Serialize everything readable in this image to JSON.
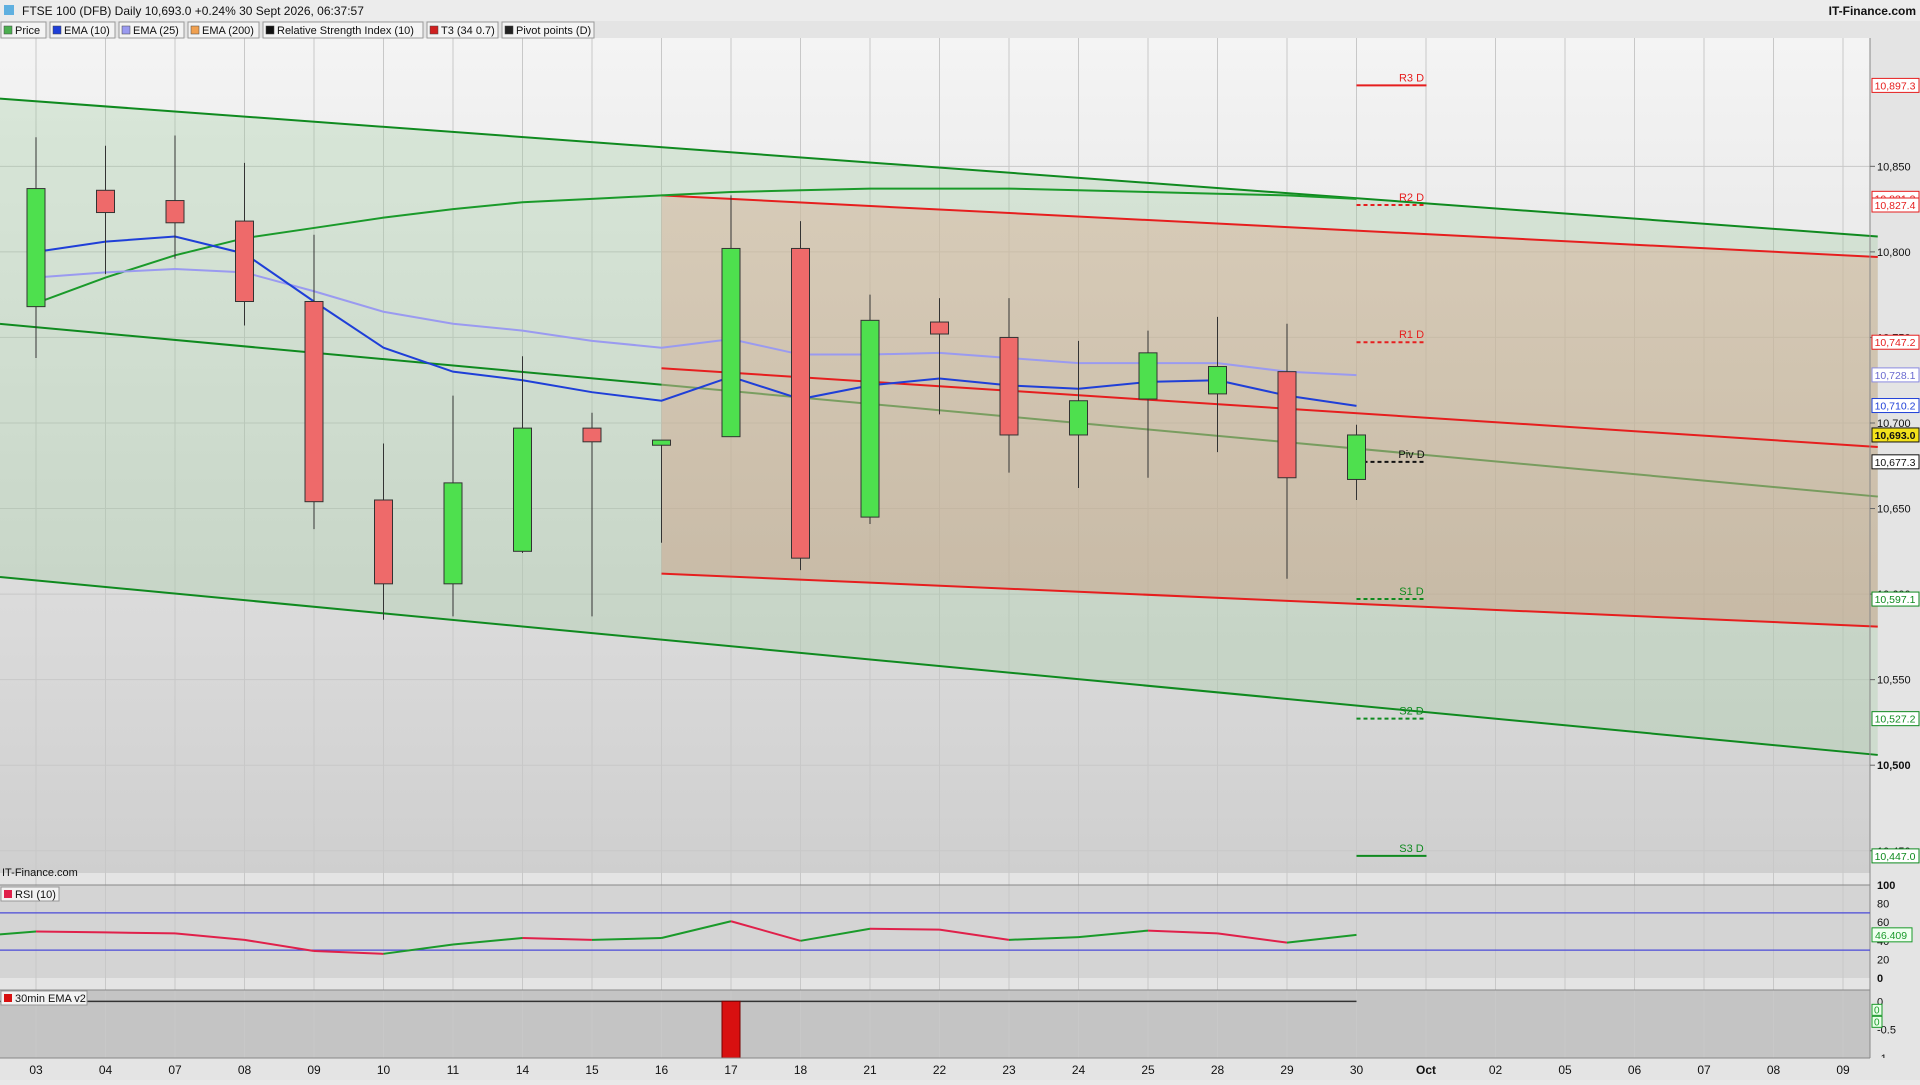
{
  "header": {
    "title": "FTSE 100 (DFB) Daily 10,693.0 +0.24% 30 Sept 2026, 06:37:57",
    "brand": "IT-Finance.com",
    "watermark": "IT-Finance.com"
  },
  "legend": [
    {
      "label": "Price",
      "color": "#4caf50"
    },
    {
      "label": "EMA (10)",
      "color": "#1f3fd8"
    },
    {
      "label": "EMA (25)",
      "color": "#9a9af0"
    },
    {
      "label": "EMA (200)",
      "color": "#f0a050"
    },
    {
      "label": "Relative Strength Index (10)",
      "color": "#111111"
    },
    {
      "label": "T3 (34 0.7)",
      "color": "#d02020"
    },
    {
      "label": "Pivot points (D)",
      "color": "#222222"
    }
  ],
  "colors": {
    "up": "#4ee04e",
    "down": "#ee6a6a",
    "ema10": "#1f3fd8",
    "ema25": "#9a9af0",
    "ema200": "#1a9a2a",
    "channel_green": "#0f8a1f",
    "channel_red": "#e61e1e",
    "rsi_up": "#1a9a2a",
    "rsi_down": "#e0204a"
  },
  "chart_data": [
    {
      "type": "candlestick",
      "title": "FTSE 100 (DFB) Daily",
      "x_ticks": [
        "03",
        "04",
        "07",
        "08",
        "09",
        "10",
        "11",
        "14",
        "15",
        "16",
        "17",
        "18",
        "21",
        "22",
        "23",
        "24",
        "25",
        "28",
        "29",
        "30",
        "Oct",
        "02",
        "05",
        "06",
        "07",
        "08",
        "09"
      ],
      "y_ticks": [
        "10,850",
        "10,800",
        "10,750",
        "10,700",
        "10,650",
        "10,600",
        "10,550",
        "10,500",
        "10,450"
      ],
      "ylim": [
        10437,
        10925
      ],
      "candles": [
        {
          "date": "03",
          "open": 10768,
          "high": 10867,
          "low": 10738,
          "close": 10837
        },
        {
          "date": "04",
          "open": 10836,
          "high": 10862,
          "low": 10787,
          "close": 10823
        },
        {
          "date": "07",
          "open": 10830,
          "high": 10868,
          "low": 10796,
          "close": 10817
        },
        {
          "date": "08",
          "open": 10818,
          "high": 10852,
          "low": 10757,
          "close": 10771
        },
        {
          "date": "09",
          "open": 10771,
          "high": 10810,
          "low": 10638,
          "close": 10654
        },
        {
          "date": "10",
          "open": 10655,
          "high": 10688,
          "low": 10585,
          "close": 10606
        },
        {
          "date": "11",
          "open": 10606,
          "high": 10716,
          "low": 10587,
          "close": 10665
        },
        {
          "date": "14",
          "open": 10625,
          "high": 10739,
          "low": 10624,
          "close": 10697
        },
        {
          "date": "15",
          "open": 10697,
          "high": 10706,
          "low": 10587,
          "close": 10689
        },
        {
          "date": "16",
          "open": 10687,
          "high": 10690,
          "low": 10630,
          "close": 10690
        },
        {
          "date": "17",
          "open": 10692,
          "high": 10833,
          "low": 10692,
          "close": 10802
        },
        {
          "date": "18",
          "open": 10802,
          "high": 10818,
          "low": 10614,
          "close": 10621
        },
        {
          "date": "21",
          "open": 10645,
          "high": 10775,
          "low": 10641,
          "close": 10760
        },
        {
          "date": "22",
          "open": 10759,
          "high": 10773,
          "low": 10705,
          "close": 10752
        },
        {
          "date": "23",
          "open": 10750,
          "high": 10773,
          "low": 10671,
          "close": 10693
        },
        {
          "date": "24",
          "open": 10693,
          "high": 10748,
          "low": 10662,
          "close": 10713
        },
        {
          "date": "25",
          "open": 10714,
          "high": 10754,
          "low": 10668,
          "close": 10741
        },
        {
          "date": "28",
          "open": 10717,
          "high": 10762,
          "low": 10683,
          "close": 10733
        },
        {
          "date": "29",
          "open": 10730,
          "high": 10758,
          "low": 10609,
          "close": 10668
        },
        {
          "date": "30",
          "open": 10667,
          "high": 10699,
          "low": 10655,
          "close": 10693
        }
      ],
      "ema10": [
        10800,
        10806,
        10809,
        10799,
        10771,
        10744,
        10730,
        10725,
        10718,
        10713,
        10727,
        10714,
        10722,
        10726,
        10722,
        10720,
        10724,
        10725,
        10716,
        10710
      ],
      "ema25": [
        10785,
        10788,
        10790,
        10788,
        10777,
        10765,
        10758,
        10754,
        10748,
        10744,
        10749,
        10740,
        10740,
        10741,
        10738,
        10735,
        10735,
        10735,
        10730,
        10728
      ],
      "ema200": [
        10770,
        10785,
        10798,
        10808,
        10814,
        10820,
        10825,
        10829,
        10831,
        10833,
        10835,
        10836,
        10837,
        10837,
        10837,
        10836,
        10835,
        10834,
        10833,
        10831
      ],
      "price_labels": [
        "10,897.3",
        "10,831.3",
        "10,827.4",
        "10,747.2",
        "10,728.1",
        "10,710.2",
        "10,693.0",
        "10,677.3",
        "10,597.1",
        "10,527.2",
        "10,447.0"
      ],
      "pivots": [
        {
          "label": "R3 D",
          "value": 10897.3,
          "style": "solid",
          "color": "#e61e1e"
        },
        {
          "label": "R2 D",
          "value": 10827.4,
          "style": "dashed",
          "color": "#e61e1e"
        },
        {
          "label": "R1 D",
          "value": 10747.2,
          "style": "dashed",
          "color": "#e61e1e"
        },
        {
          "label": "Piv D",
          "value": 10677.3,
          "style": "dashed",
          "color": "#111111"
        },
        {
          "label": "S1 D",
          "value": 10597.1,
          "style": "dashed",
          "color": "#0f8a1f"
        },
        {
          "label": "S2 D",
          "value": 10527.2,
          "style": "dashed",
          "color": "#0f8a1f"
        },
        {
          "label": "S3 D",
          "value": 10447.0,
          "style": "solid",
          "color": "#0f8a1f"
        }
      ],
      "channel_green": {
        "start_date": "03",
        "end_index": 26.5,
        "upper": [
          10888,
          10809
        ],
        "middle": [
          10756,
          10657
        ],
        "lower": [
          10608,
          10506
        ]
      },
      "channel_red": {
        "start_date": "16",
        "end_index": 26.5,
        "upper": [
          10833,
          10797
        ],
        "middle": [
          10732,
          10686
        ],
        "lower": [
          10612,
          10581
        ]
      }
    },
    {
      "type": "line",
      "title": "RSI (10)",
      "ylim": [
        0,
        100
      ],
      "y_ticks": [
        "100",
        "80",
        "60",
        "40",
        "20",
        "0"
      ],
      "levels": [
        70,
        30
      ],
      "current_label": "46.409",
      "values": [
        44,
        50,
        49,
        48,
        41,
        29,
        26,
        36,
        43,
        41,
        43,
        61,
        40,
        53,
        52,
        41,
        44,
        51,
        48,
        38,
        46.409
      ]
    },
    {
      "type": "bar",
      "title": "30min EMA v2",
      "ylim": [
        -1,
        0.2
      ],
      "y_ticks": [
        "0",
        "-0.5",
        "-1"
      ],
      "labels": [
        "0",
        "0"
      ],
      "values": [
        {
          "date": "17",
          "value": -1
        }
      ]
    }
  ]
}
